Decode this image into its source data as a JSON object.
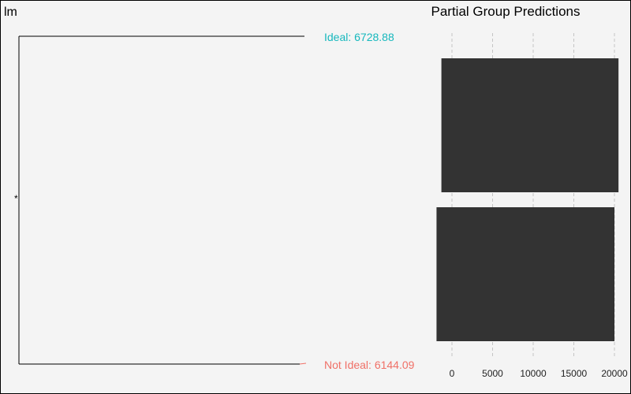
{
  "model_label": "lm",
  "significance_mark": "*",
  "chart_data": [
    {
      "type": "line",
      "comparison": [
        {
          "label": "Ideal: 6728.88",
          "value": 6728.88,
          "color": "#16b8bd"
        },
        {
          "label": "Not Ideal: 6144.09",
          "value": 6144.09,
          "color": "#f07067"
        }
      ]
    },
    {
      "type": "bar",
      "title": "Partial Group Predictions",
      "xlim": [
        -2000,
        21000
      ],
      "x_ticks": [
        0,
        5000,
        10000,
        15000,
        20000
      ],
      "grid": "vertical-dashed",
      "bars": [
        {
          "group": "Ideal",
          "from": -1300,
          "to": 20500
        },
        {
          "group": "Not Ideal",
          "from": -1900,
          "to": 20000
        }
      ],
      "bar_color": "#333333"
    }
  ]
}
